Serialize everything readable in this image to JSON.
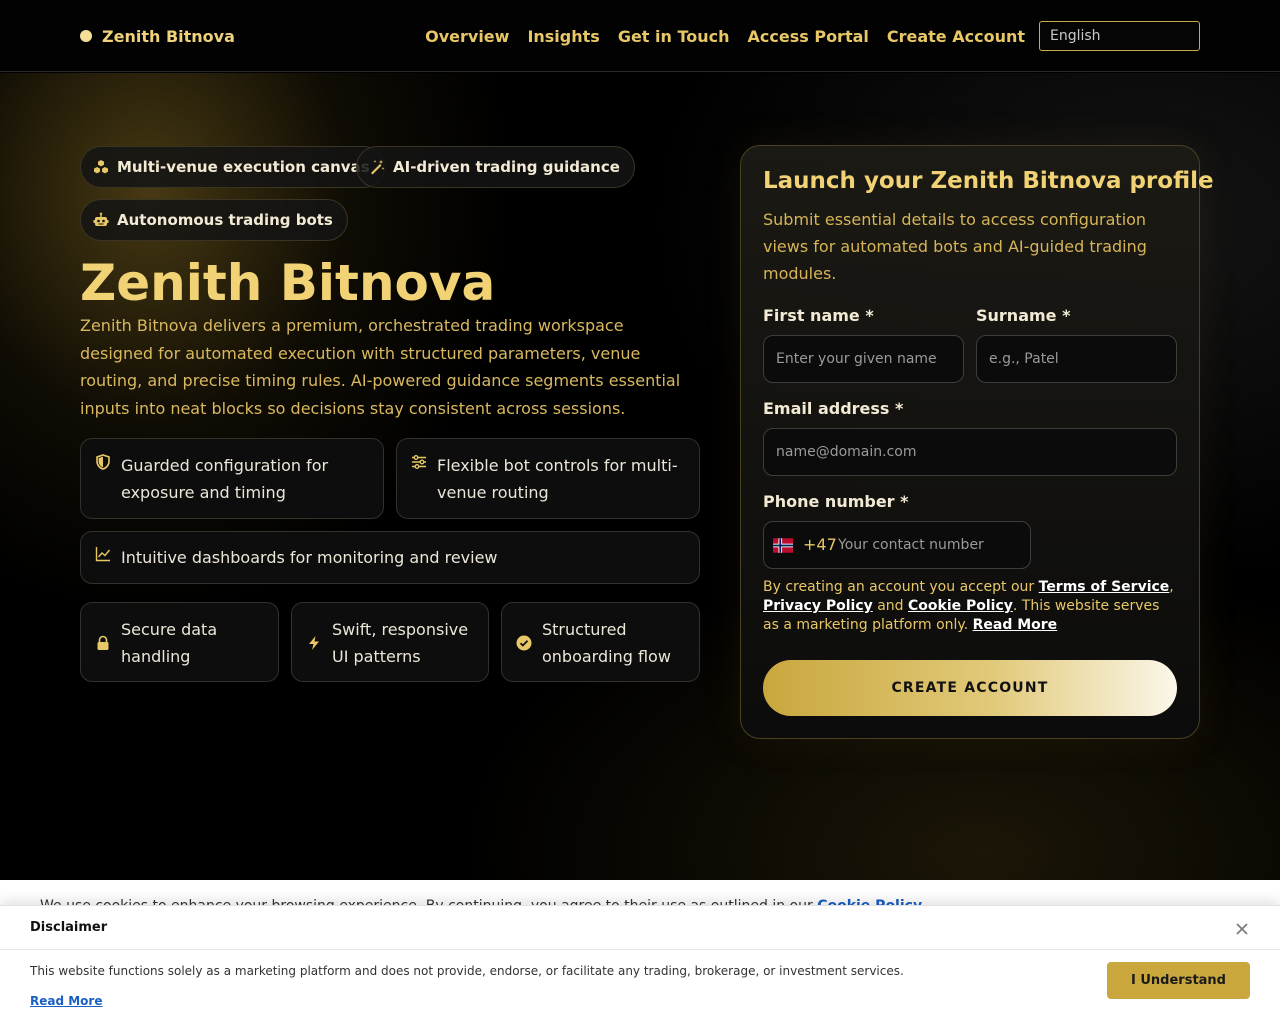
{
  "header": {
    "brand": "Zenith Bitnova",
    "nav": [
      "Overview",
      "Insights",
      "Get in Touch",
      "Access Portal",
      "Create Account"
    ],
    "language": "English"
  },
  "hero": {
    "chips": [
      "Multi-venue execution canvas",
      "AI-driven trading guidance",
      "Autonomous trading bots"
    ],
    "title": "Zenith Bitnova",
    "description": "Zenith Bitnova delivers a premium, orchestrated trading workspace designed for automated execution with structured parameters, venue routing, and precise timing rules. AI-powered guidance segments essential inputs into neat blocks so decisions stay consistent across sessions.",
    "features": [
      "Guarded configuration for exposure and timing",
      "Flexible bot controls for multi-venue routing",
      "Intuitive dashboards for monitoring and review",
      "Secure data handling",
      "Swift, responsive UI patterns",
      "Structured onboarding flow"
    ]
  },
  "form": {
    "title": "Launch your Zenith Bitnova profile",
    "subtitle": "Submit essential details to access configuration views for automated bots and AI-guided trading modules.",
    "first_name_label": "First name *",
    "first_name_placeholder": "Enter your given name",
    "surname_label": "Surname *",
    "surname_placeholder": "e.g., Patel",
    "email_label": "Email address *",
    "email_placeholder": "name@domain.com",
    "phone_label": "Phone number *",
    "dial_code": "+47",
    "phone_placeholder": "Your contact number",
    "terms_prefix": "By creating an account you accept our ",
    "terms_link": "Terms of Service",
    "terms_comma": ", ",
    "privacy_link": "Privacy Policy",
    "terms_and": " and ",
    "cookie_link": "Cookie Policy",
    "terms_suffix": ". This website serves as a marketing platform only. ",
    "read_more": "Read More",
    "submit": "CREATE ACCOUNT"
  },
  "cookie_strip": {
    "text": "We use cookies to enhance your browsing experience. By continuing, you agree to their use as outlined in our ",
    "link": "Cookie Policy"
  },
  "disclaimer": {
    "title": "Disclaimer",
    "text": "This website functions solely as a marketing platform and does not provide, endorse, or facilitate any trading, brokerage, or investment services.",
    "read_more": "Read More",
    "button": "I Understand"
  },
  "colors": {
    "accent": "#e8c766",
    "title_gold": "#f1d274",
    "background": "#000000",
    "disclaimer_button": "#c9a73d",
    "link_blue": "#1a5fc4"
  },
  "icons": {
    "chips": [
      "cubes-icon",
      "magic-wand-icon",
      "robot-icon"
    ],
    "features": [
      "shield-icon",
      "sliders-icon",
      "chart-line-icon",
      "lock-icon",
      "bolt-icon",
      "check-circle-icon"
    ],
    "flag": "norway-flag-icon",
    "close": "close-icon"
  }
}
